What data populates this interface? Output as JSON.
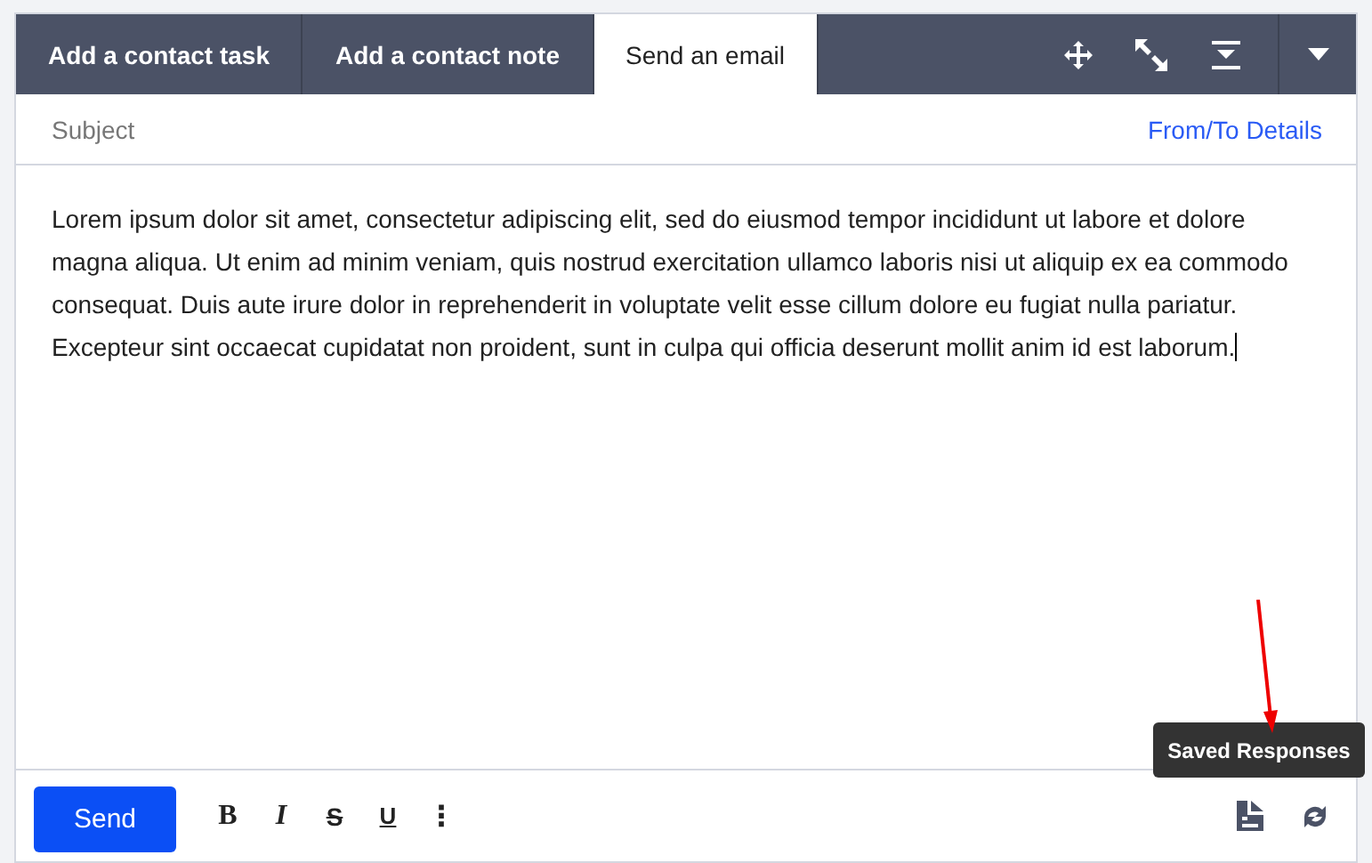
{
  "tabs": [
    {
      "label": "Add a contact task",
      "selected": false
    },
    {
      "label": "Add a contact note",
      "selected": false
    },
    {
      "label": "Send an email",
      "selected": true
    }
  ],
  "subject": {
    "placeholder": "Subject"
  },
  "details_link": "From/To Details",
  "body": "Lorem ipsum dolor sit amet, consectetur adipiscing elit, sed do eiusmod tempor incididunt ut labore et dolore magna aliqua. Ut enim ad minim veniam, quis nostrud exercitation ullamco laboris nisi ut aliquip ex ea commodo consequat. Duis aute irure dolor in reprehenderit in voluptate velit esse cillum dolore eu fugiat nulla pariatur. Excepteur sint occaecat cupidatat non proident, sunt in culpa qui officia deserunt mollit anim id est laborum.",
  "send_button": "Send",
  "format_buttons": [
    {
      "kind": "bold",
      "label": "B"
    },
    {
      "kind": "italic",
      "label": "I"
    },
    {
      "kind": "strike",
      "label": "S"
    },
    {
      "kind": "underline",
      "label": "U"
    },
    {
      "kind": "more",
      "label": "⋮"
    }
  ],
  "tooltip": "Saved Responses"
}
